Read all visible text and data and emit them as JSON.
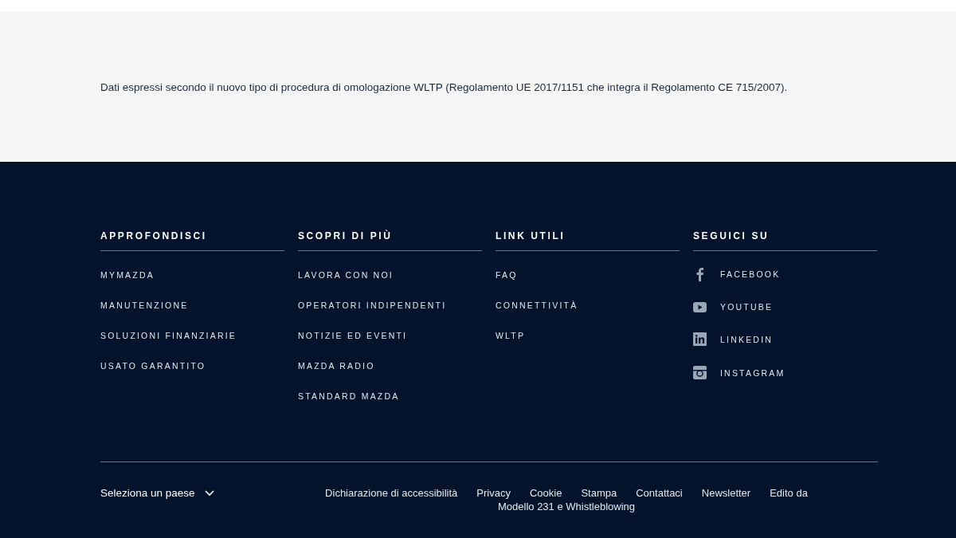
{
  "disclaimer": "Dati espressi secondo il nuovo tipo di procedura di omologazione WLTP (Regolamento UE 2017/1151 che integra il Regolamento CE 715/2007).",
  "footer_columns": [
    {
      "heading": "APPROFONDISCI",
      "links": [
        {
          "label": "MYMAZDA"
        },
        {
          "label": "MANUTENZIONE"
        },
        {
          "label": "SOLUZIONI FINANZIARIE"
        },
        {
          "label": "USATO GARANTITO"
        }
      ]
    },
    {
      "heading": "SCOPRI DI PIÙ",
      "links": [
        {
          "label": "LAVORA CON NOI"
        },
        {
          "label": "OPERATORI INDIPENDENTI"
        },
        {
          "label": "NOTIZIE ED EVENTI"
        },
        {
          "label": "MAZDA RADIO"
        },
        {
          "label": "STANDARD MAZDA"
        }
      ]
    },
    {
      "heading": "LINK UTILI",
      "links": [
        {
          "label": "FAQ"
        },
        {
          "label": "CONNETTIVITÀ"
        },
        {
          "label": "WLTP"
        }
      ]
    },
    {
      "heading": "SEGUICI SU",
      "links": [
        {
          "label": "FACEBOOK",
          "kind": "facebook"
        },
        {
          "label": "YOUTUBE",
          "kind": "youtube"
        },
        {
          "label": "LINKEDIN",
          "kind": "linkedin"
        },
        {
          "label": "INSTAGRAM",
          "kind": "instagram"
        }
      ]
    }
  ],
  "country_selector": "Seleziona un paese",
  "legal_links": [
    "Dichiarazione di accessibilità",
    "Privacy",
    "Cookie",
    "Stampa",
    "Contattaci",
    "Newsletter",
    "Edito da",
    "Modello 231 e Whistleblowing"
  ]
}
